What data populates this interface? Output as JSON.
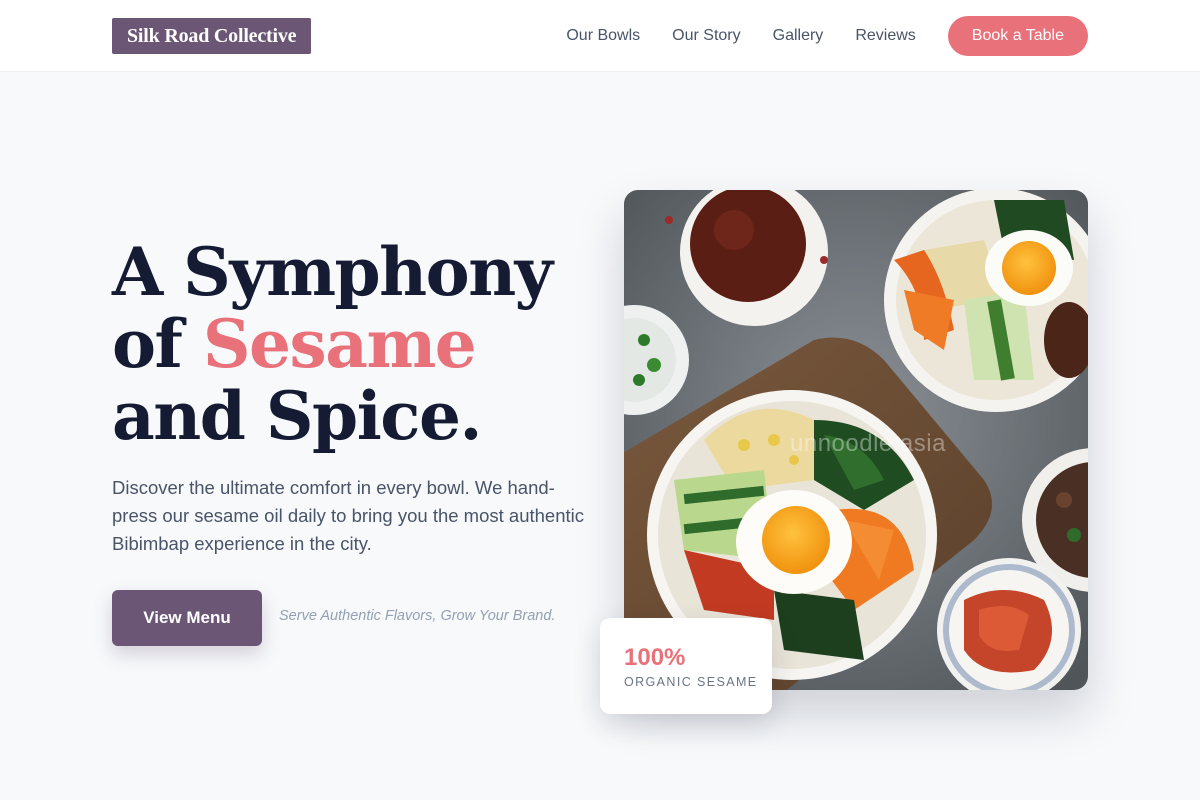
{
  "brand": {
    "name": "Silk Road Collective"
  },
  "nav": {
    "links": [
      "Our Bowls",
      "Our Story",
      "Gallery",
      "Reviews"
    ],
    "cta_label": "Book a Table"
  },
  "hero": {
    "title_line1": "A Symphony",
    "title_line2_prefix": "of ",
    "title_line2_accent": "Sesame",
    "title_line3": "and Spice.",
    "description": "Discover the ultimate comfort in every bowl. We hand-press our sesame oil daily to bring you the most authentic Bibimbap experience in the city.",
    "primary_button": "View Menu",
    "tagline": "Serve Authentic Flavors, Grow Your Brand.",
    "image_watermark": "unnoodle.asia"
  },
  "stat": {
    "value": "100%",
    "label": "ORGANIC SESAME"
  },
  "colors": {
    "brand_purple": "#6b5676",
    "accent_coral": "#e8717a",
    "heading_navy": "#141b33",
    "page_bg": "#f7f9fb"
  }
}
